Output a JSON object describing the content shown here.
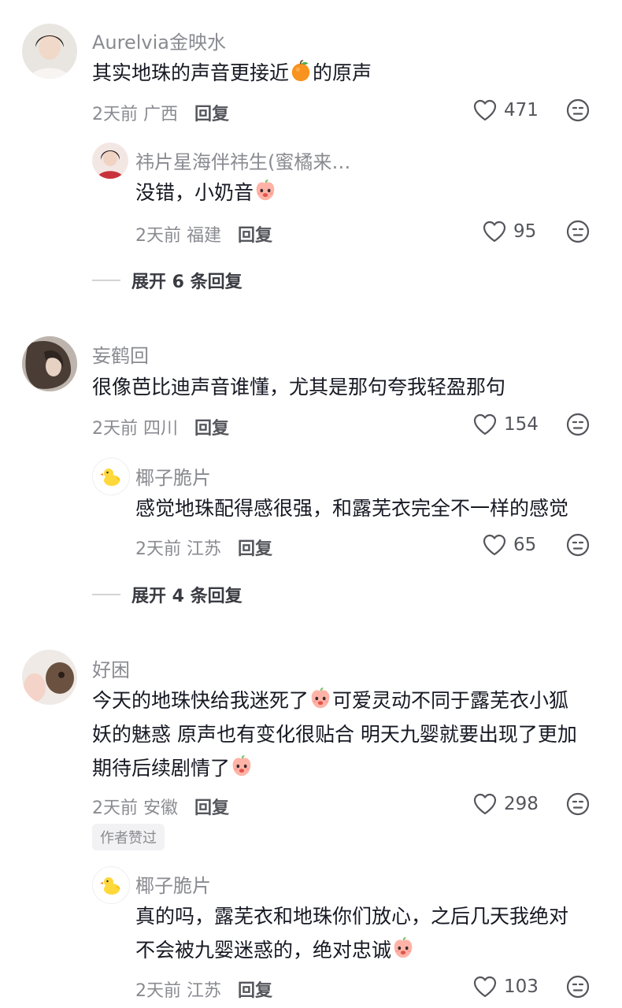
{
  "comments": [
    {
      "author": "Aurelvia金映水",
      "text_parts": [
        "其实地珠的声音更接近",
        "的原声"
      ],
      "emoji": "orange-emoji",
      "time": "2天前",
      "location": "广西",
      "reply_label": "回复",
      "likes": "471",
      "reply": {
        "author": "祎片星海伴祎生(蜜橘来…",
        "text": "没错，小奶音",
        "emoji": "peach-emoji",
        "time": "2天前",
        "location": "福建",
        "reply_label": "回复",
        "likes": "95"
      },
      "expand_label": "展开 6 条回复"
    },
    {
      "author": "妄鹤回",
      "text": "很像芭比迪声音谁懂，尤其是那句夸我轻盈那句",
      "time": "2天前",
      "location": "四川",
      "reply_label": "回复",
      "likes": "154",
      "reply": {
        "author": "椰子脆片",
        "text": "感觉地珠配得感很强，和露芜衣完全不一样的感觉",
        "time": "2天前",
        "location": "江苏",
        "reply_label": "回复",
        "likes": "65"
      },
      "expand_label": "展开 4 条回复"
    },
    {
      "author": "好困",
      "text_line1": "今天的地珠快给我迷死了",
      "text_line1b": "可爱灵动不同于露芜衣小狐",
      "text_line2": "妖的魅惑 原声也有变化很贴合 明天九婴就要出现了更加",
      "text_line3": "期待后续剧情了",
      "time": "2天前",
      "location": "安徽",
      "reply_label": "回复",
      "likes": "298",
      "badge": "作者赞过",
      "reply": {
        "author": "椰子脆片",
        "text_line1": "真的吗，露芜衣和地珠你们放心，之后几天我绝对",
        "text_line2": "不会被九婴迷惑的，绝对忠诚",
        "time": "2天前",
        "location": "江苏",
        "reply_label": "回复",
        "likes": "103"
      }
    }
  ],
  "colors": {
    "text": "#161823",
    "muted": "#8a8b91",
    "bg": "#ffffff"
  }
}
